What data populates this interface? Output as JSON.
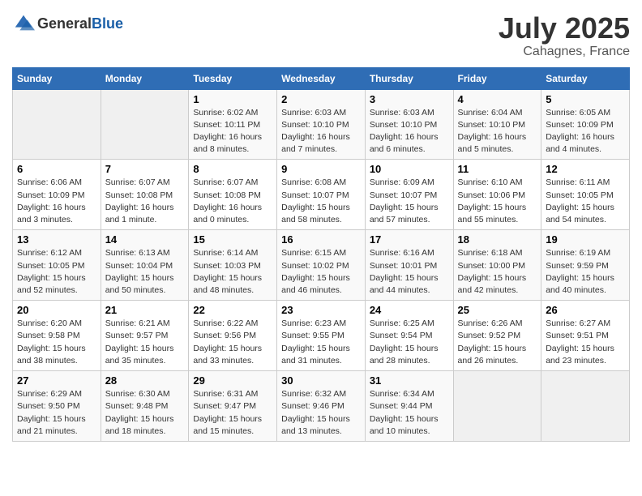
{
  "header": {
    "logo_general": "General",
    "logo_blue": "Blue",
    "month": "July 2025",
    "location": "Cahagnes, France"
  },
  "days_of_week": [
    "Sunday",
    "Monday",
    "Tuesday",
    "Wednesday",
    "Thursday",
    "Friday",
    "Saturday"
  ],
  "weeks": [
    [
      {
        "day": "",
        "sunrise": "",
        "sunset": "",
        "daylight": ""
      },
      {
        "day": "",
        "sunrise": "",
        "sunset": "",
        "daylight": ""
      },
      {
        "day": "1",
        "sunrise": "Sunrise: 6:02 AM",
        "sunset": "Sunset: 10:11 PM",
        "daylight": "Daylight: 16 hours and 8 minutes."
      },
      {
        "day": "2",
        "sunrise": "Sunrise: 6:03 AM",
        "sunset": "Sunset: 10:10 PM",
        "daylight": "Daylight: 16 hours and 7 minutes."
      },
      {
        "day": "3",
        "sunrise": "Sunrise: 6:03 AM",
        "sunset": "Sunset: 10:10 PM",
        "daylight": "Daylight: 16 hours and 6 minutes."
      },
      {
        "day": "4",
        "sunrise": "Sunrise: 6:04 AM",
        "sunset": "Sunset: 10:10 PM",
        "daylight": "Daylight: 16 hours and 5 minutes."
      },
      {
        "day": "5",
        "sunrise": "Sunrise: 6:05 AM",
        "sunset": "Sunset: 10:09 PM",
        "daylight": "Daylight: 16 hours and 4 minutes."
      }
    ],
    [
      {
        "day": "6",
        "sunrise": "Sunrise: 6:06 AM",
        "sunset": "Sunset: 10:09 PM",
        "daylight": "Daylight: 16 hours and 3 minutes."
      },
      {
        "day": "7",
        "sunrise": "Sunrise: 6:07 AM",
        "sunset": "Sunset: 10:08 PM",
        "daylight": "Daylight: 16 hours and 1 minute."
      },
      {
        "day": "8",
        "sunrise": "Sunrise: 6:07 AM",
        "sunset": "Sunset: 10:08 PM",
        "daylight": "Daylight: 16 hours and 0 minutes."
      },
      {
        "day": "9",
        "sunrise": "Sunrise: 6:08 AM",
        "sunset": "Sunset: 10:07 PM",
        "daylight": "Daylight: 15 hours and 58 minutes."
      },
      {
        "day": "10",
        "sunrise": "Sunrise: 6:09 AM",
        "sunset": "Sunset: 10:07 PM",
        "daylight": "Daylight: 15 hours and 57 minutes."
      },
      {
        "day": "11",
        "sunrise": "Sunrise: 6:10 AM",
        "sunset": "Sunset: 10:06 PM",
        "daylight": "Daylight: 15 hours and 55 minutes."
      },
      {
        "day": "12",
        "sunrise": "Sunrise: 6:11 AM",
        "sunset": "Sunset: 10:05 PM",
        "daylight": "Daylight: 15 hours and 54 minutes."
      }
    ],
    [
      {
        "day": "13",
        "sunrise": "Sunrise: 6:12 AM",
        "sunset": "Sunset: 10:05 PM",
        "daylight": "Daylight: 15 hours and 52 minutes."
      },
      {
        "day": "14",
        "sunrise": "Sunrise: 6:13 AM",
        "sunset": "Sunset: 10:04 PM",
        "daylight": "Daylight: 15 hours and 50 minutes."
      },
      {
        "day": "15",
        "sunrise": "Sunrise: 6:14 AM",
        "sunset": "Sunset: 10:03 PM",
        "daylight": "Daylight: 15 hours and 48 minutes."
      },
      {
        "day": "16",
        "sunrise": "Sunrise: 6:15 AM",
        "sunset": "Sunset: 10:02 PM",
        "daylight": "Daylight: 15 hours and 46 minutes."
      },
      {
        "day": "17",
        "sunrise": "Sunrise: 6:16 AM",
        "sunset": "Sunset: 10:01 PM",
        "daylight": "Daylight: 15 hours and 44 minutes."
      },
      {
        "day": "18",
        "sunrise": "Sunrise: 6:18 AM",
        "sunset": "Sunset: 10:00 PM",
        "daylight": "Daylight: 15 hours and 42 minutes."
      },
      {
        "day": "19",
        "sunrise": "Sunrise: 6:19 AM",
        "sunset": "Sunset: 9:59 PM",
        "daylight": "Daylight: 15 hours and 40 minutes."
      }
    ],
    [
      {
        "day": "20",
        "sunrise": "Sunrise: 6:20 AM",
        "sunset": "Sunset: 9:58 PM",
        "daylight": "Daylight: 15 hours and 38 minutes."
      },
      {
        "day": "21",
        "sunrise": "Sunrise: 6:21 AM",
        "sunset": "Sunset: 9:57 PM",
        "daylight": "Daylight: 15 hours and 35 minutes."
      },
      {
        "day": "22",
        "sunrise": "Sunrise: 6:22 AM",
        "sunset": "Sunset: 9:56 PM",
        "daylight": "Daylight: 15 hours and 33 minutes."
      },
      {
        "day": "23",
        "sunrise": "Sunrise: 6:23 AM",
        "sunset": "Sunset: 9:55 PM",
        "daylight": "Daylight: 15 hours and 31 minutes."
      },
      {
        "day": "24",
        "sunrise": "Sunrise: 6:25 AM",
        "sunset": "Sunset: 9:54 PM",
        "daylight": "Daylight: 15 hours and 28 minutes."
      },
      {
        "day": "25",
        "sunrise": "Sunrise: 6:26 AM",
        "sunset": "Sunset: 9:52 PM",
        "daylight": "Daylight: 15 hours and 26 minutes."
      },
      {
        "day": "26",
        "sunrise": "Sunrise: 6:27 AM",
        "sunset": "Sunset: 9:51 PM",
        "daylight": "Daylight: 15 hours and 23 minutes."
      }
    ],
    [
      {
        "day": "27",
        "sunrise": "Sunrise: 6:29 AM",
        "sunset": "Sunset: 9:50 PM",
        "daylight": "Daylight: 15 hours and 21 minutes."
      },
      {
        "day": "28",
        "sunrise": "Sunrise: 6:30 AM",
        "sunset": "Sunset: 9:48 PM",
        "daylight": "Daylight: 15 hours and 18 minutes."
      },
      {
        "day": "29",
        "sunrise": "Sunrise: 6:31 AM",
        "sunset": "Sunset: 9:47 PM",
        "daylight": "Daylight: 15 hours and 15 minutes."
      },
      {
        "day": "30",
        "sunrise": "Sunrise: 6:32 AM",
        "sunset": "Sunset: 9:46 PM",
        "daylight": "Daylight: 15 hours and 13 minutes."
      },
      {
        "day": "31",
        "sunrise": "Sunrise: 6:34 AM",
        "sunset": "Sunset: 9:44 PM",
        "daylight": "Daylight: 15 hours and 10 minutes."
      },
      {
        "day": "",
        "sunrise": "",
        "sunset": "",
        "daylight": ""
      },
      {
        "day": "",
        "sunrise": "",
        "sunset": "",
        "daylight": ""
      }
    ]
  ]
}
